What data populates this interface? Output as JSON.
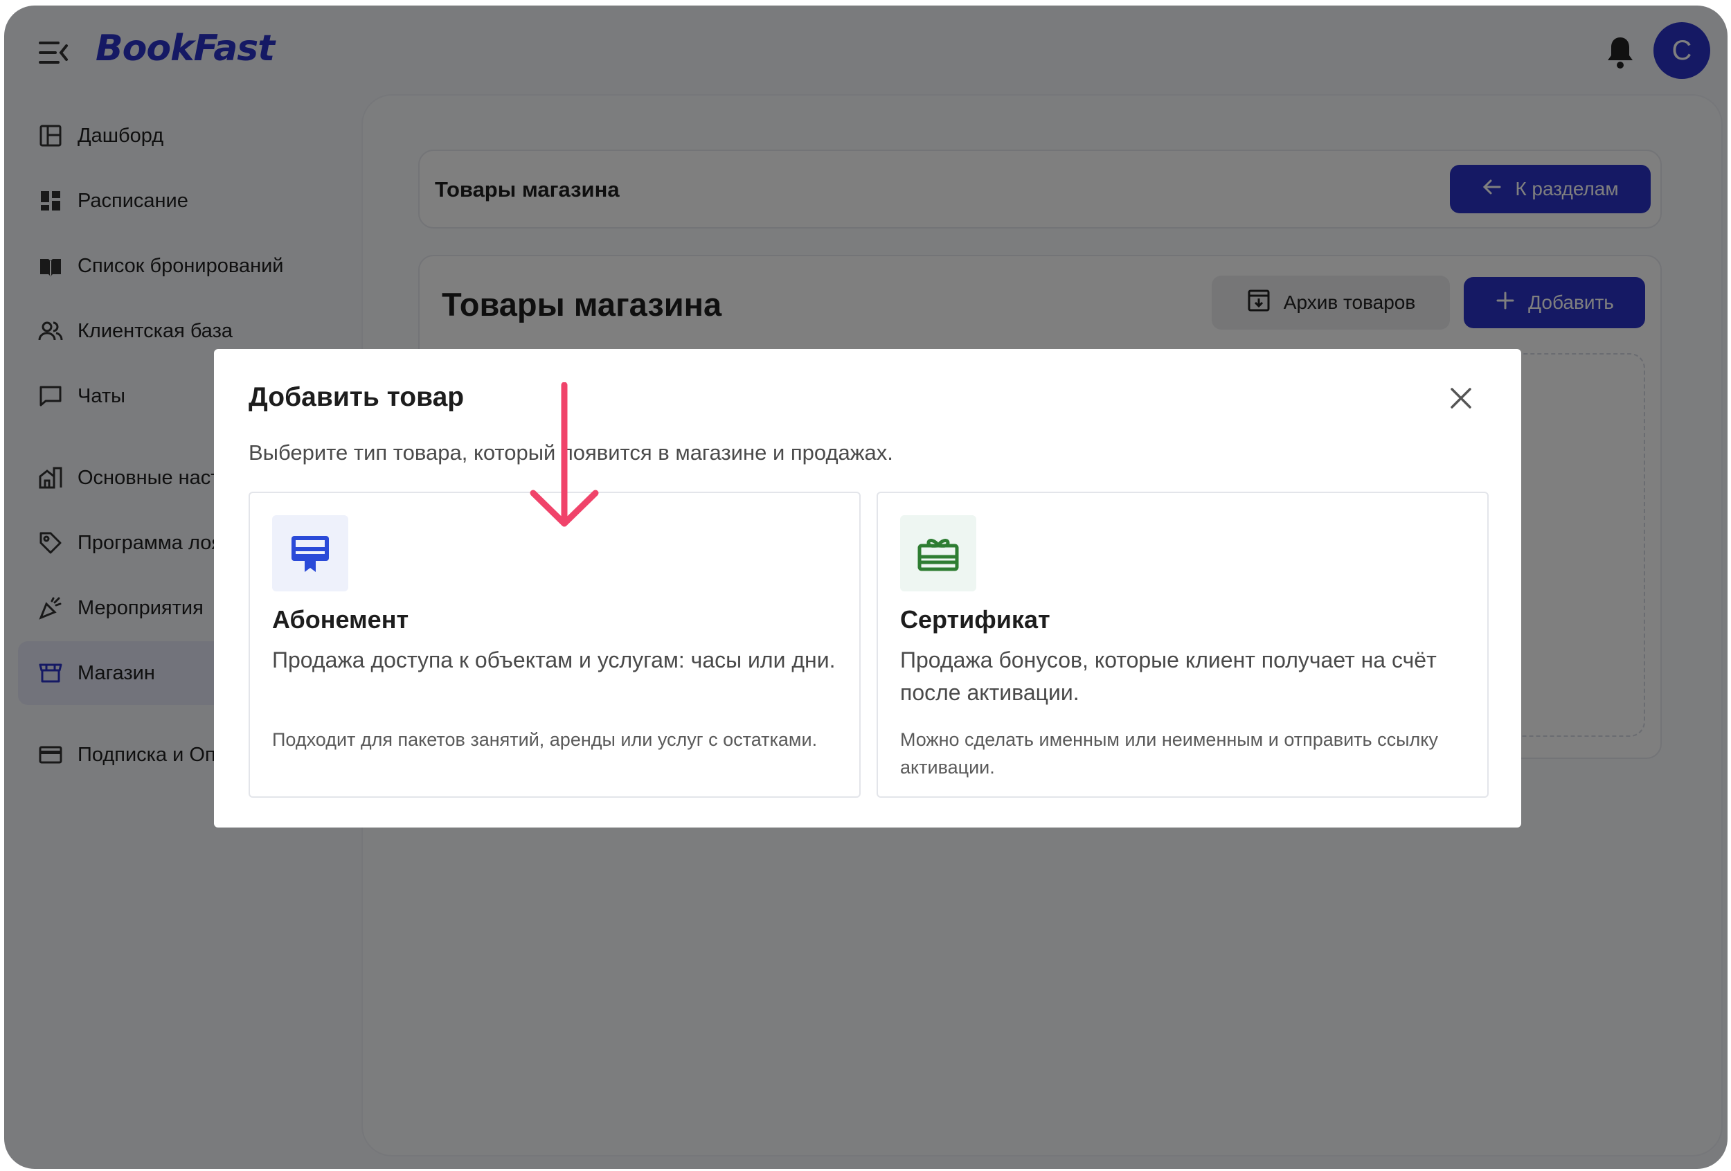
{
  "header": {
    "logo": "BookFast",
    "avatar_letter": "C"
  },
  "sidebar": {
    "items": [
      {
        "label": "Дашборд",
        "icon": "dashboard-icon"
      },
      {
        "label": "Расписание",
        "icon": "schedule-icon"
      },
      {
        "label": "Список бронирований",
        "icon": "book-icon"
      },
      {
        "label": "Клиентская база",
        "icon": "clients-icon"
      },
      {
        "label": "Чаты",
        "icon": "chat-icon"
      },
      {
        "label": "Основные настройки",
        "icon": "settings-building-icon"
      },
      {
        "label": "Программа лояльности",
        "icon": "loyalty-tag-icon"
      },
      {
        "label": "Мероприятия",
        "icon": "party-icon"
      },
      {
        "label": "Магазин",
        "icon": "store-icon",
        "active": true
      },
      {
        "label": "Подписка и Оплата",
        "icon": "card-icon"
      }
    ]
  },
  "main": {
    "section_title": "Товары магазина",
    "back_button": "К разделам",
    "page_title": "Товары магазина",
    "archive_button": "Архив товаров",
    "add_button": "Добавить"
  },
  "modal": {
    "title": "Добавить товар",
    "subtitle": "Выберите тип товара, который появится в магазине и продажах.",
    "options": [
      {
        "title": "Абонемент",
        "description": "Продажа доступа к объектам и услугам: часы или дни.",
        "note": "Подходит для пакетов занятий, аренды или услуг с остатками.",
        "icon": "subscription-ticket-icon",
        "icon_color": "#2a4ad8",
        "icon_bg": "#eef1fb"
      },
      {
        "title": "Сертификат",
        "description": "Продажа бонусов, которые клиент получает на счёт после активации.",
        "note": "Можно сделать именным или неименным и отправить ссылку активации.",
        "icon": "gift-certificate-icon",
        "icon_color": "#2e7d32",
        "icon_bg": "#eef6f2"
      }
    ]
  },
  "colors": {
    "brand": "#2a32c8",
    "annotation_arrow": "#f0436a"
  }
}
